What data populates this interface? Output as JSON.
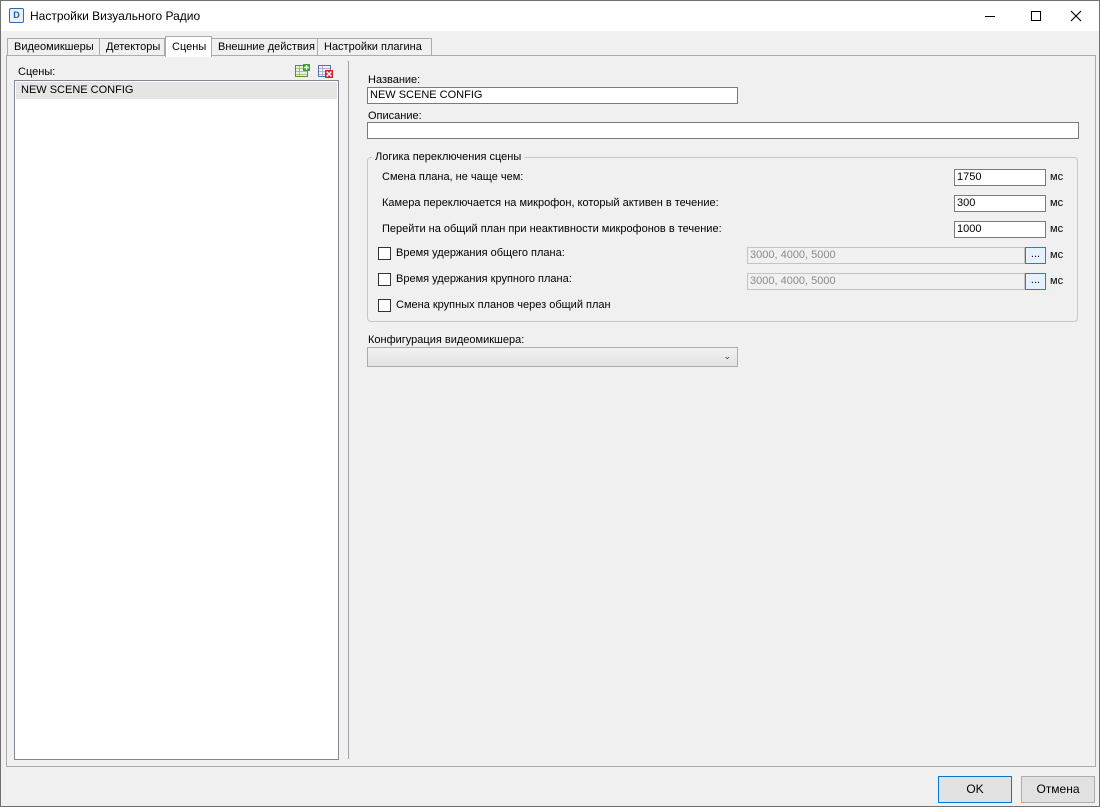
{
  "window": {
    "title": "Настройки Визуального Радио",
    "icon": "radio-app-icon",
    "icon_text": "D"
  },
  "tabs": [
    {
      "label": "Видеомикшеры"
    },
    {
      "label": "Детекторы"
    },
    {
      "label": "Сцены",
      "active": true
    },
    {
      "label": "Внешние действия"
    },
    {
      "label": "Настройки плагина"
    }
  ],
  "scenes": {
    "label": "Сцены:",
    "items": [
      "NEW SCENE CONFIG"
    ],
    "add_icon": "add-scene-icon",
    "delete_icon": "delete-scene-icon"
  },
  "form": {
    "name_label": "Название:",
    "name_value": "NEW SCENE CONFIG",
    "description_label": "Описание:",
    "description_value": "",
    "logic_group_title": "Логика переключения сцены",
    "rows": [
      {
        "label": "Смена плана, не чаще чем:",
        "value": "1750",
        "unit": "мс"
      },
      {
        "label": "Камера переключается на микрофон, который активен в течение:",
        "value": "300",
        "unit": "мс"
      },
      {
        "label": "Перейти на общий план при неактивности микрофонов в течение:",
        "value": "1000",
        "unit": "мс"
      }
    ],
    "hold_general": {
      "label": "Время удержания общего плана:",
      "checked": false,
      "value": "3000, 4000, 5000",
      "button": "...",
      "unit": "мс"
    },
    "hold_closeup": {
      "label": "Время удержания крупного плана:",
      "checked": false,
      "value": "3000, 4000, 5000",
      "button": "...",
      "unit": "мс"
    },
    "closeup_via_general": {
      "label": "Смена крупных планов через общий план",
      "checked": false
    },
    "mixer_config_label": "Конфигурация видеомикшера:",
    "mixer_config_value": ""
  },
  "buttons": {
    "ok": "OK",
    "cancel": "Отмена"
  },
  "colors": {
    "window_bg": "#f0f0f0",
    "accent": "#0078d7"
  }
}
